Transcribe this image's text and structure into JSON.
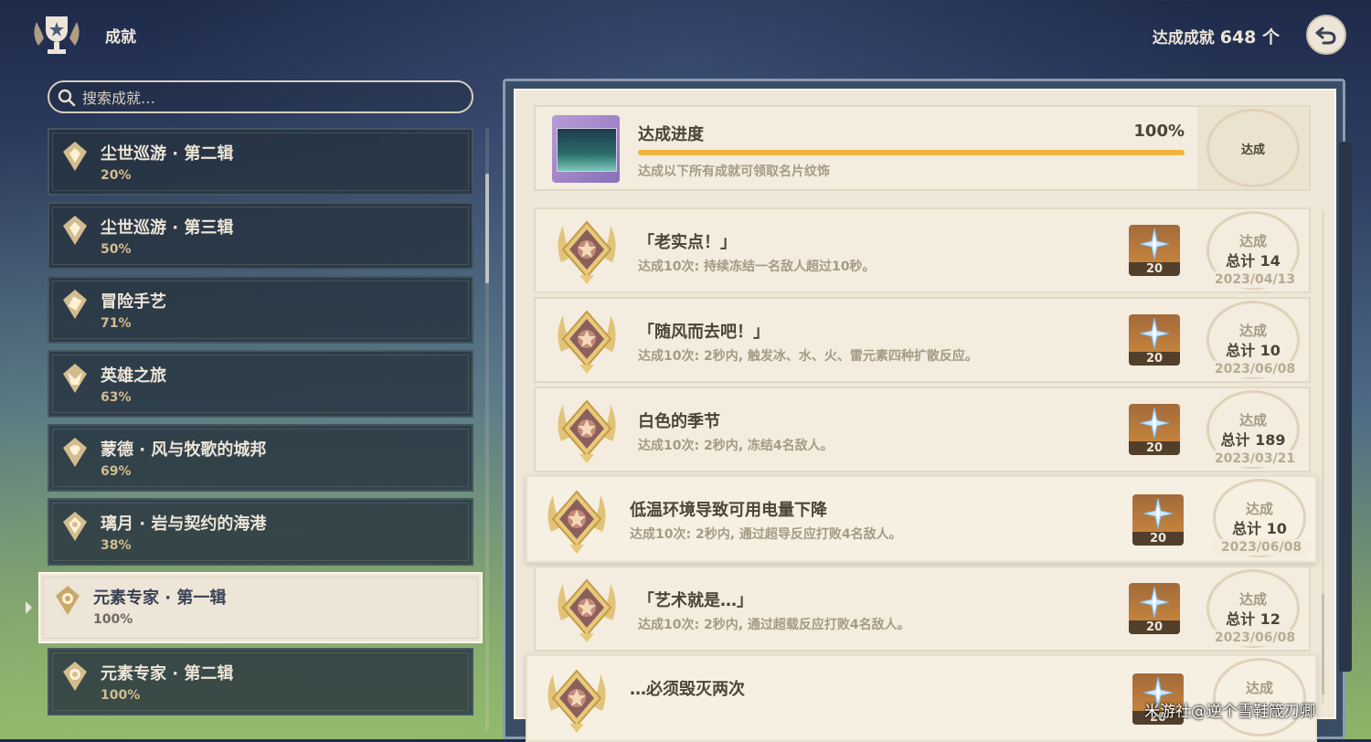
{
  "header": {
    "title": "成就",
    "total_label": "达成成就",
    "total_count": "648 个"
  },
  "search": {
    "placeholder": "搜索成就…"
  },
  "categories": [
    {
      "name": "尘世巡游 · 第二辑",
      "percent": "20%"
    },
    {
      "name": "尘世巡游 · 第三辑",
      "percent": "50%"
    },
    {
      "name": "冒险手艺",
      "percent": "71%"
    },
    {
      "name": "英雄之旅",
      "percent": "63%"
    },
    {
      "name": "蒙德 · 风与牧歌的城邦",
      "percent": "69%"
    },
    {
      "name": "璃月 · 岩与契约的海港",
      "percent": "38%"
    },
    {
      "name": "元素专家 · 第一辑",
      "percent": "100%",
      "selected": true
    },
    {
      "name": "元素专家 · 第二辑",
      "percent": "100%"
    }
  ],
  "progress": {
    "title": "达成进度",
    "percent": "100%",
    "value": 1.0,
    "description": "达成以下所有成就可领取名片纹饰",
    "seal_label": "达成"
  },
  "achievements": [
    {
      "title": "「老实点！」",
      "description": "达成10次: 持续冻结一名敌人超过10秒。",
      "reward": "20",
      "status": "达成",
      "total": "总计 14",
      "date": "2023/04/13"
    },
    {
      "title": "「随风而去吧！」",
      "description": "达成10次: 2秒内, 触发冰、水、火、雷元素四种扩散反应。",
      "reward": "20",
      "status": "达成",
      "total": "总计 10",
      "date": "2023/06/08"
    },
    {
      "title": "白色的季节",
      "description": "达成10次: 2秒内, 冻结4名敌人。",
      "reward": "20",
      "status": "达成",
      "total": "总计 189",
      "date": "2023/03/21"
    },
    {
      "title": "低温环境导致可用电量下降",
      "description": "达成10次: 2秒内, 通过超导反应打败4名敌人。",
      "reward": "20",
      "status": "达成",
      "total": "总计 10",
      "date": "2023/06/08"
    },
    {
      "title": "「艺术就是…」",
      "description": "达成10次: 2秒内, 通过超载反应打败4名敌人。",
      "reward": "20",
      "status": "达成",
      "total": "总计 12",
      "date": "2023/06/08"
    },
    {
      "title": "…必须毁灭两次",
      "description": "",
      "reward": "20",
      "status": "达成",
      "total": "",
      "date": ""
    }
  ],
  "watermark": "米游社@逆个雪鞋箴刃卿",
  "colors": {
    "accent_gold": "#efb43c",
    "panel_cream": "#efe7d8",
    "text_dark": "#4a4536"
  }
}
